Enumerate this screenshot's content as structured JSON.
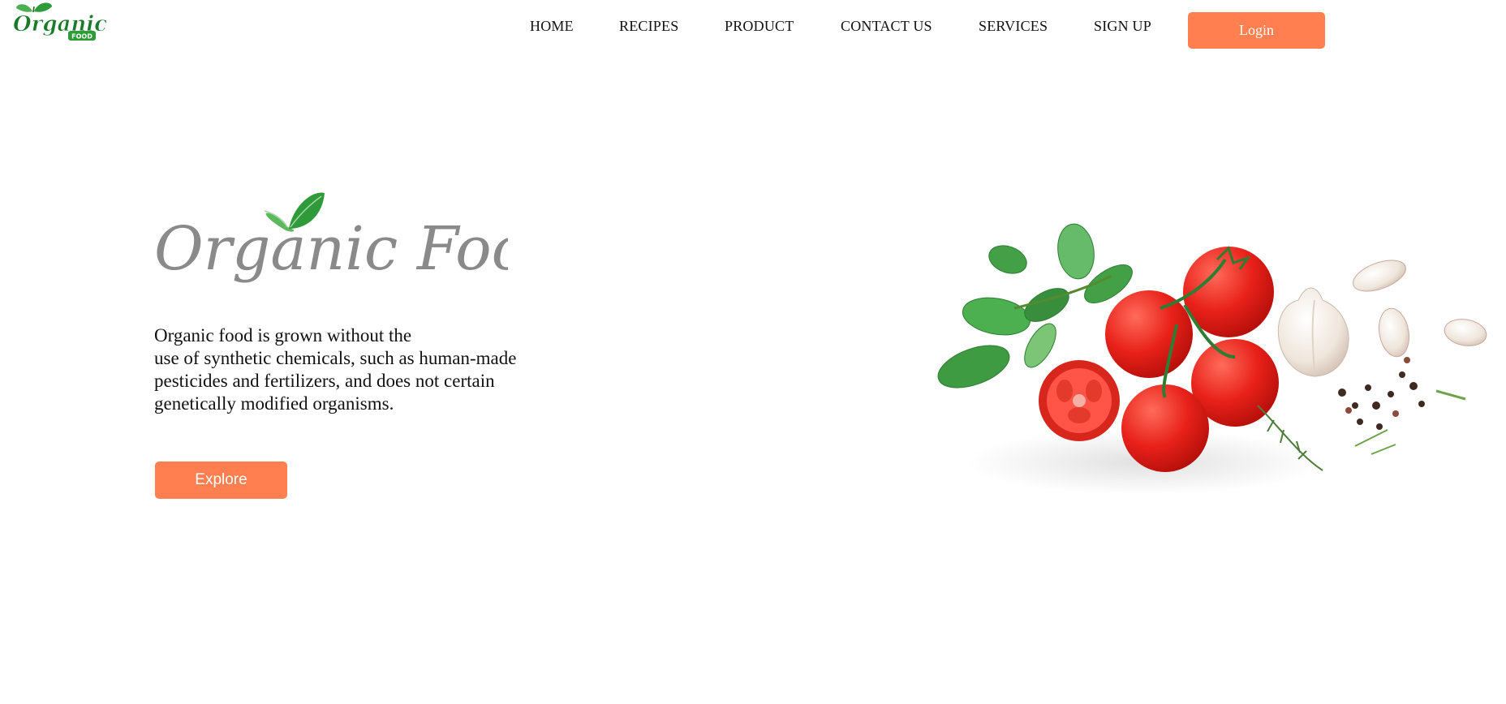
{
  "header": {
    "logo": {
      "word": "Organic",
      "sub": "FOOD"
    },
    "nav": [
      {
        "label": "HOME"
      },
      {
        "label": "RECIPES"
      },
      {
        "label": "PRODUCT"
      },
      {
        "label": "CONTACT US"
      },
      {
        "label": "SERVICES"
      },
      {
        "label": "SIGN UP"
      }
    ],
    "login_label": "Login"
  },
  "hero": {
    "title": "Organic Food",
    "description_lines": [
      "Organic food is grown without the",
      "use of synthetic chemicals, such as human-made",
      "pesticides and fertilizers, and does not certain",
      "genetically modified organisms."
    ],
    "explore_label": "Explore"
  },
  "colors": {
    "accent": "#ff7f50",
    "leaf_green": "#2e9a3a",
    "title_gray": "#8a8a8a"
  },
  "icons": {
    "logo": "organic-food-logo-icon",
    "title_leaves": "leaves-icon",
    "hero_image": "tomatoes-basil-garlic-illustration"
  }
}
